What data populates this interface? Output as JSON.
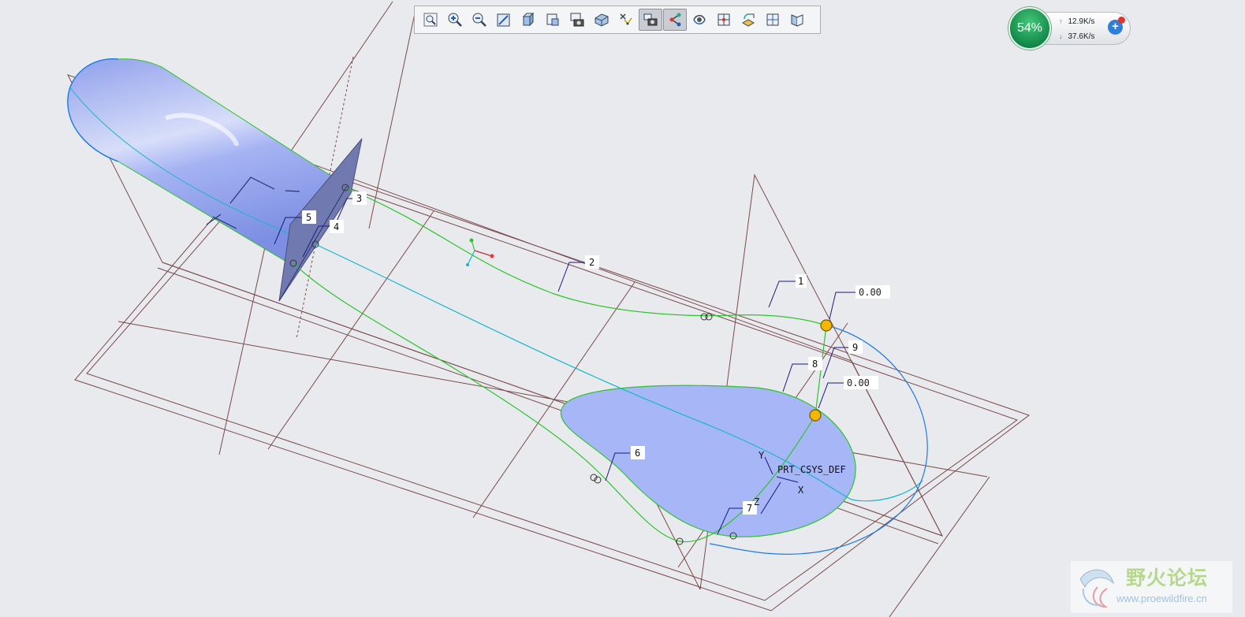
{
  "toolbar": {
    "buttons": [
      {
        "name": "refit-icon",
        "active": false
      },
      {
        "name": "zoom-in-icon",
        "active": false
      },
      {
        "name": "zoom-out-icon",
        "active": false
      },
      {
        "name": "repaint-icon",
        "active": false
      },
      {
        "name": "display-style-icon",
        "active": false
      },
      {
        "name": "saved-views-icon",
        "active": false
      },
      {
        "name": "view-manager-icon",
        "active": false
      },
      {
        "name": "perspective-view-icon",
        "active": false
      },
      {
        "name": "datum-display-icon",
        "active": false
      },
      {
        "name": "spin-center-icon",
        "active": true
      },
      {
        "name": "annotation-display-icon",
        "active": true
      },
      {
        "name": "plane-display-icon",
        "active": false
      },
      {
        "name": "grid-icon",
        "active": false
      },
      {
        "name": "orient-icon",
        "active": false
      },
      {
        "name": "layout-icon",
        "active": false
      },
      {
        "name": "section-icon",
        "active": false
      }
    ]
  },
  "net_monitor": {
    "percent": "54%",
    "upload": "12.9K/s",
    "download": "37.6K/s",
    "up_arrow": "↑",
    "down_arrow": "↓",
    "plus": "+"
  },
  "model": {
    "csys_label": "PRT_CSYS_DEF",
    "axis_x": "X",
    "axis_y": "Y",
    "axis_z": "Z",
    "dimension_1": "0.00",
    "dimension_2": "0.00",
    "curve_labels": [
      "1",
      "2",
      "3",
      "4",
      "5",
      "6",
      "7",
      "8",
      "9"
    ],
    "colors": {
      "datum_plane": "#7a4a4a",
      "sketch_curve": "#2fc42f",
      "boundary_curve": "#1f7be0",
      "centerline": "#18b6c7",
      "surface": "#a7b6f6",
      "handle": "#f5b800"
    }
  },
  "watermark": {
    "text_cn": "野火论坛",
    "url": "www.proewildfire.cn"
  }
}
